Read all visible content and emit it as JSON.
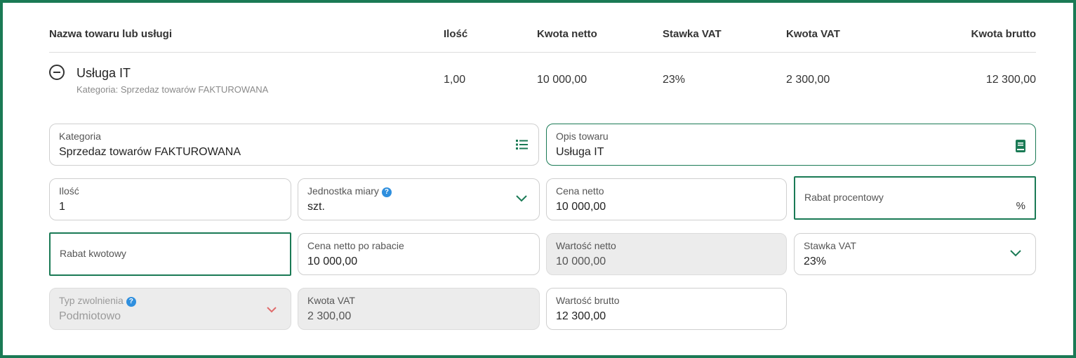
{
  "table": {
    "headers": {
      "name": "Nazwa towaru lub usługi",
      "qty": "Ilość",
      "net": "Kwota netto",
      "vat_rate": "Stawka VAT",
      "vat_amount": "Kwota VAT",
      "gross": "Kwota brutto"
    },
    "row": {
      "name": "Usługa IT",
      "category": "Kategoria: Sprzedaz towarów FAKTUROWANA",
      "qty": "1,00",
      "net": "10 000,00",
      "vat_rate": "23%",
      "vat_amount": "2 300,00",
      "gross": "12 300,00"
    }
  },
  "form": {
    "kategoria": {
      "label": "Kategoria",
      "value": "Sprzedaz towarów FAKTUROWANA"
    },
    "opis": {
      "label": "Opis towaru",
      "value": "Usługa IT"
    },
    "ilosc": {
      "label": "Ilość",
      "value": "1"
    },
    "jednostka": {
      "label": "Jednostka miary",
      "value": "szt.",
      "help": "?"
    },
    "cena_netto": {
      "label": "Cena netto",
      "value": "10 000,00"
    },
    "rabat_proc": {
      "label": "Rabat procentowy",
      "suffix": "%"
    },
    "rabat_kwot": {
      "label": "Rabat kwotowy"
    },
    "cena_po_rabacie": {
      "label": "Cena netto po rabacie",
      "value": "10 000,00"
    },
    "wartosc_netto": {
      "label": "Wartość netto",
      "value": "10 000,00"
    },
    "stawka_vat": {
      "label": "Stawka VAT",
      "value": "23%"
    },
    "typ_zwolnienia": {
      "label": "Typ zwolnienia",
      "value": "Podmiotowo",
      "help": "?"
    },
    "kwota_vat": {
      "label": "Kwota VAT",
      "value": "2 300,00"
    },
    "wartosc_brutto": {
      "label": "Wartość brutto",
      "value": "12 300,00"
    }
  },
  "colors": {
    "accent": "#1a7a55",
    "help": "#2f8fde",
    "chevron_disabled": "#e06b6b"
  },
  "icons": {
    "collapse": "minus-circle-icon",
    "category_list": "list-icon",
    "description_book": "book-icon",
    "dropdown": "chevron-down-icon",
    "help": "question-icon"
  }
}
